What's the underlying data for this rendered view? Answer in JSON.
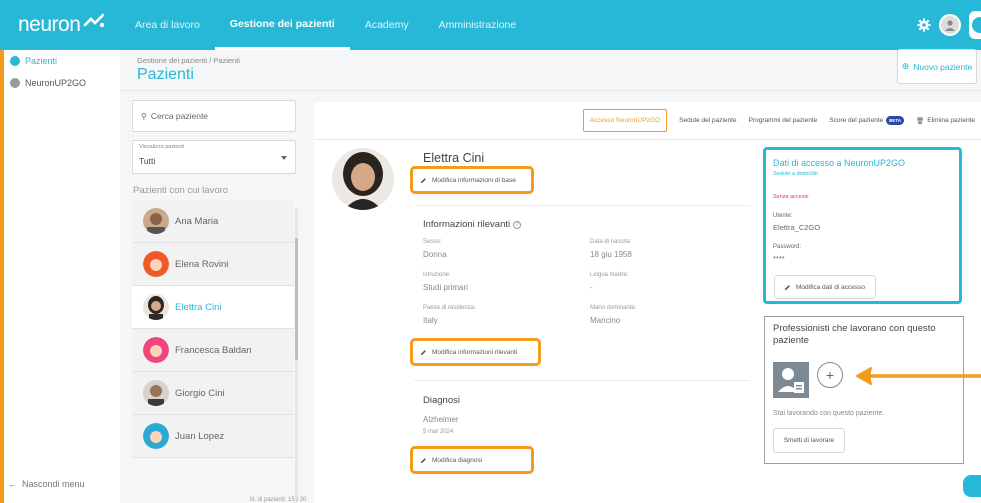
{
  "app": {
    "logo_text": "neuron"
  },
  "nav": {
    "tabs": [
      {
        "label": "Area di lavoro",
        "active": false
      },
      {
        "label": "Gestione dei pazienti",
        "active": true
      },
      {
        "label": "Academy",
        "active": false
      },
      {
        "label": "Amministrazione",
        "active": false
      }
    ]
  },
  "sidebar": {
    "items": [
      {
        "label": "Pazienti",
        "active": true
      },
      {
        "label": "NeuronUP2GO",
        "active": false
      }
    ],
    "hide_menu": "Nascondi menu"
  },
  "header": {
    "breadcrumb": "Gestione dei pazienti  /  Pazienti",
    "title": "Pazienti",
    "new_patient": "Nuovo paziente"
  },
  "list": {
    "search_placeholder": "Cerca paziente",
    "filter_label": "Visualizza pazienti",
    "filter_value": "Tutti",
    "section_title": "Pazienti con cui lavoro",
    "patients": [
      {
        "name": "Ana Maria"
      },
      {
        "name": "Elena Rovini"
      },
      {
        "name": "Elettra Cini"
      },
      {
        "name": "Francesca Baldan"
      },
      {
        "name": "Giorgio Cini"
      },
      {
        "name": "Juan Lopez"
      }
    ],
    "count": "N. di pazienti: 15 / 30"
  },
  "tabs": {
    "access": "Accesso NeuronUP2GO",
    "sessions": "Sedute del paziente",
    "programs": "Programmi del paziente",
    "scores": "Score del paziente",
    "beta": "BETA",
    "delete": "Elimina paziente"
  },
  "patient": {
    "name": "Elettra Cini",
    "edit_basic": "Modifica informazioni di base",
    "relevant_title": "Informazioni rilevanti",
    "fields": {
      "sex_label": "Sesso:",
      "sex": "Donna",
      "dob_label": "Data di nascita:",
      "dob": "18 giu 1958",
      "edu_label": "Istruzione:",
      "edu": "Studi primari",
      "lang_label": "Lingua madre:",
      "lang": "-",
      "country_label": "Paese di residenza:",
      "country": "Italy",
      "hand_label": "Mano dominante:",
      "hand": "Mancino"
    },
    "edit_relevant": "Modifica informazioni rilevanti",
    "diagnosis_title": "Diagnosi",
    "diagnosis": "Alzheimer",
    "diagnosis_date": "5 mar 2024",
    "edit_diagnosis": "Modifica diagnosi"
  },
  "access_card": {
    "title": "Dati di accesso a NeuronUP2GO",
    "subtitle": "Sedute a domicilio",
    "warning": "Senza accessi",
    "user_label": "Utente:",
    "user": "Elettra_C2GO",
    "pwd_label": "Password:",
    "pwd": "****",
    "edit": "Modifica dati di accesso"
  },
  "pros_card": {
    "title": "Professionisti che lavorano con questo paziente",
    "add": "+",
    "working": "Stai lavorando con questo paziente.",
    "stop": "Smetti di lavorare"
  }
}
